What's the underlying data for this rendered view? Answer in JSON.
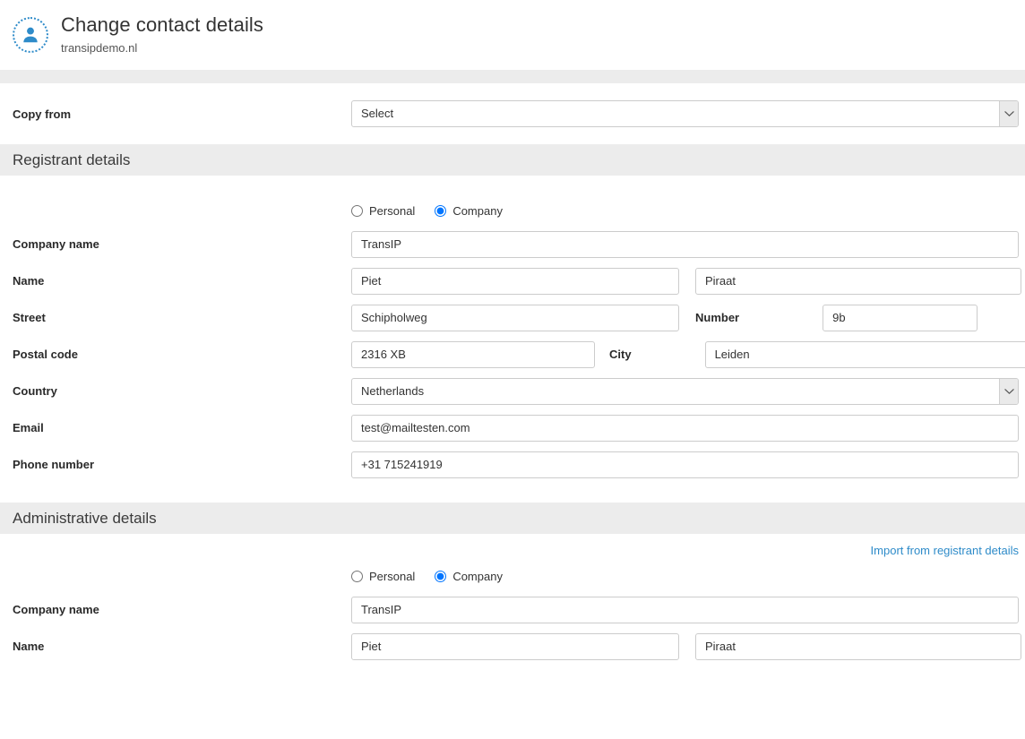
{
  "header": {
    "avatar_icon": "user-avatar-icon",
    "title": "Change contact details",
    "subtitle": "transipdemo.nl"
  },
  "copy_from": {
    "label": "Copy from",
    "selected": "Select",
    "options": [
      "Select"
    ],
    "chevron_icon": "chevron-down-icon"
  },
  "registrant": {
    "section_title": "Registrant details",
    "type_options": [
      {
        "label": "Personal",
        "checked": false
      },
      {
        "label": "Company",
        "checked": true
      }
    ],
    "fields": {
      "company_name_label": "Company name",
      "company_name_value": "TransIP",
      "name_label": "Name",
      "first_name_value": "Piet",
      "last_name_value": "Piraat",
      "street_label": "Street",
      "street_value": "Schipholweg",
      "number_label": "Number",
      "number_value": "9b",
      "postal_code_label": "Postal code",
      "postal_code_value": "2316 XB",
      "city_label": "City",
      "city_value": "Leiden",
      "country_label": "Country",
      "country_value": "Netherlands",
      "email_label": "Email",
      "email_value": "test@mailtesten.com",
      "phone_label": "Phone number",
      "phone_value": "+31 715241919"
    }
  },
  "administrative": {
    "section_title": "Administrative details",
    "import_link": "Import from registrant details",
    "type_options": [
      {
        "label": "Personal",
        "checked": false
      },
      {
        "label": "Company",
        "checked": true
      }
    ],
    "fields": {
      "company_name_label": "Company name",
      "company_name_value": "TransIP",
      "name_label": "Name",
      "first_name_value": "Piet",
      "last_name_value": "Piraat"
    }
  },
  "colors": {
    "accent": "#2e8bc9",
    "section_band": "#ececec",
    "field_border": "#cccccc",
    "text": "#333333"
  }
}
